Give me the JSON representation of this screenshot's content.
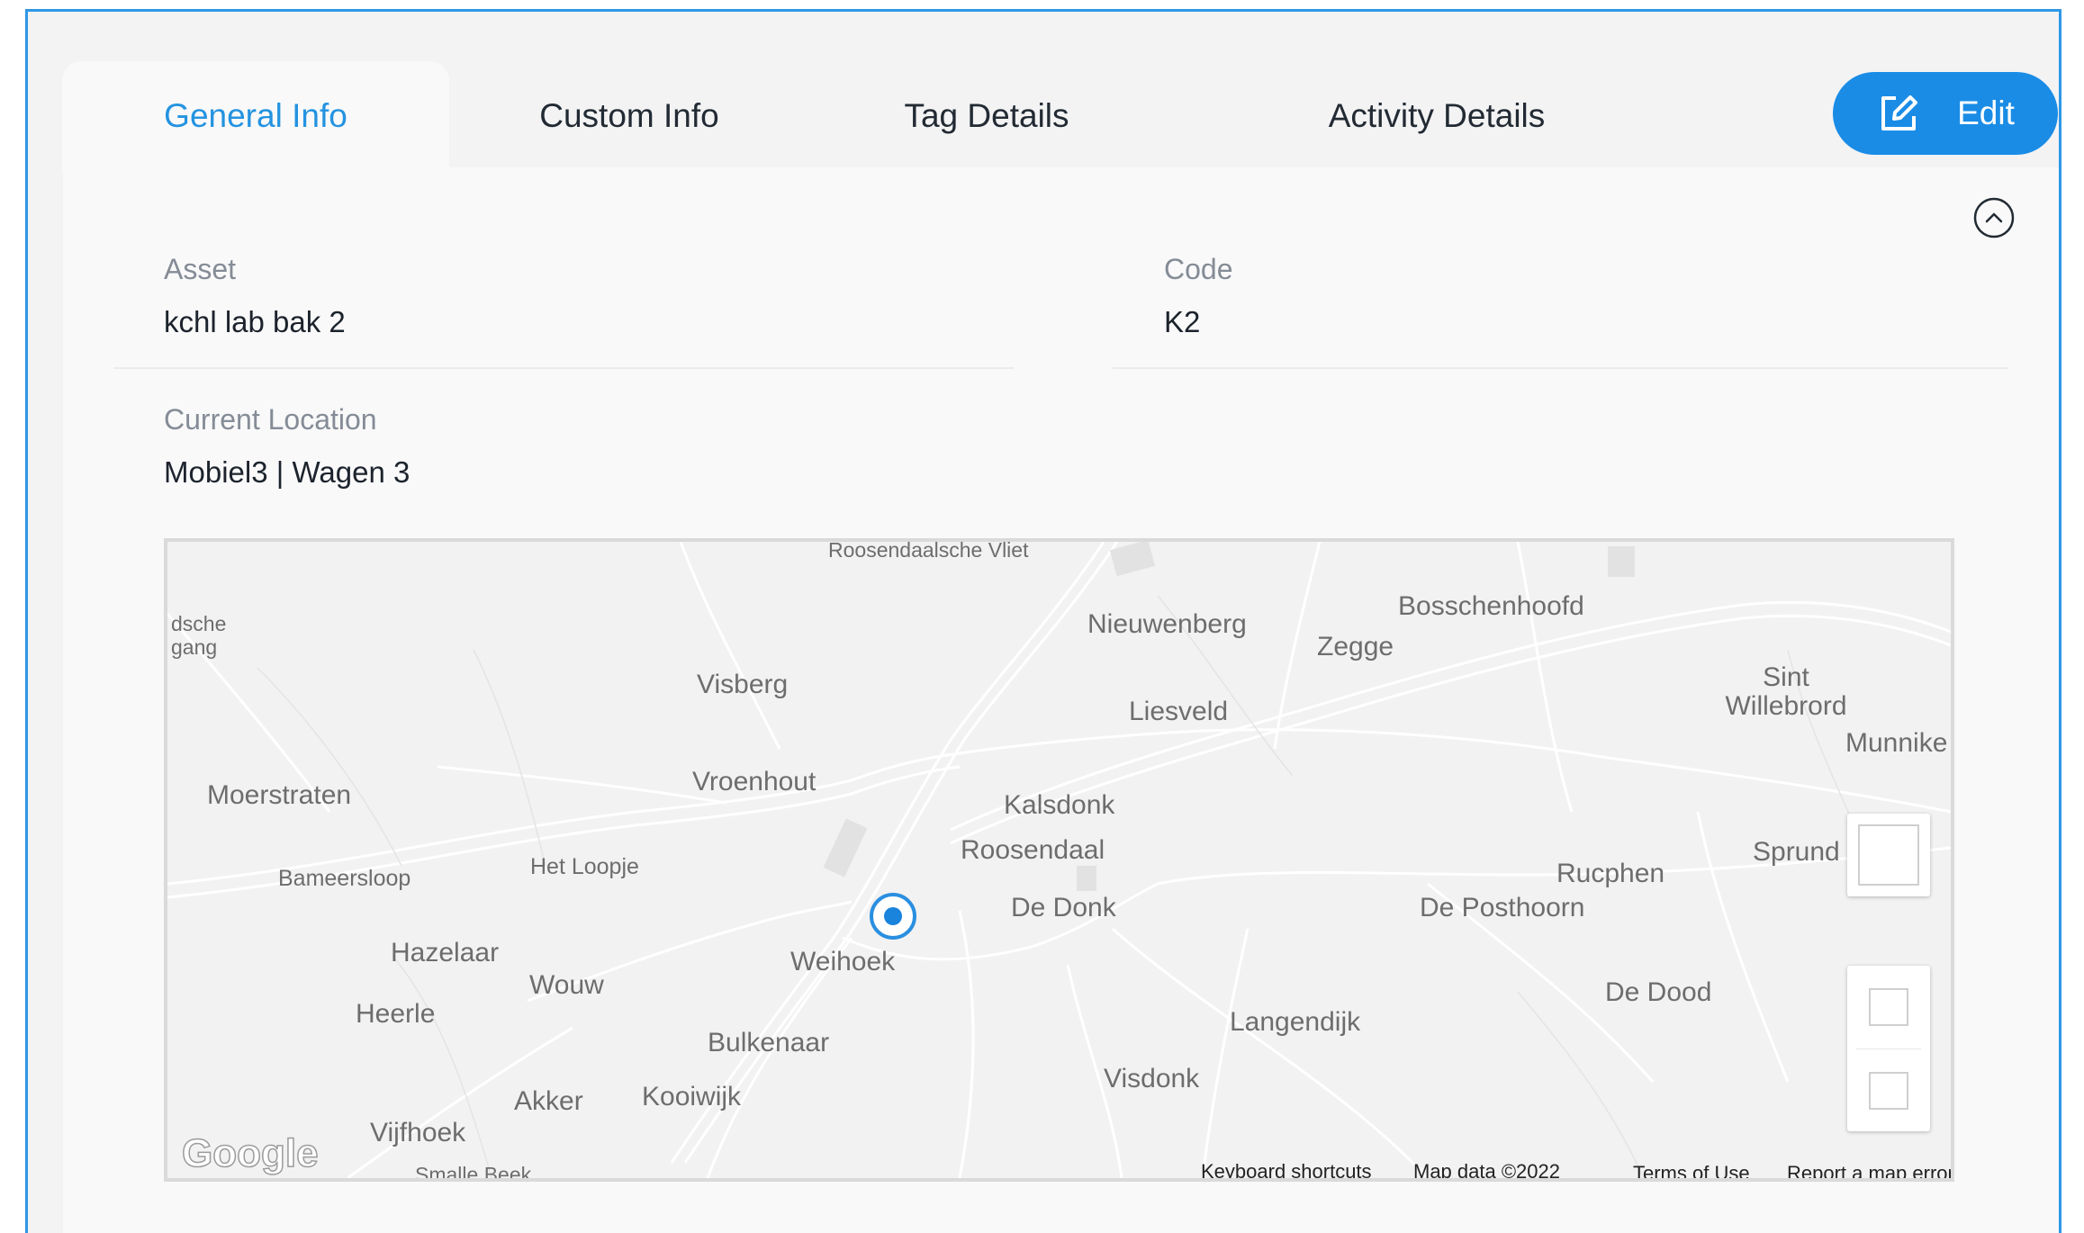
{
  "tabs": [
    {
      "label": "General Info",
      "active": true
    },
    {
      "label": "Custom Info",
      "active": false
    },
    {
      "label": "Tag Details",
      "active": false
    },
    {
      "label": "Activity Details",
      "active": false
    }
  ],
  "edit_button": {
    "label": "Edit",
    "icon": "edit-icon"
  },
  "collapse_icon": "chevron-up-circle-icon",
  "fields": {
    "asset": {
      "label": "Asset",
      "value": "kchl lab bak 2"
    },
    "code": {
      "label": "Code",
      "value": "K2"
    },
    "current_location": {
      "label": "Current Location",
      "value": "Mobiel3 | Wagen 3"
    }
  },
  "map": {
    "places": [
      "Roosendaalsche Vliet",
      "dsche gang",
      "Nieuwenberg",
      "Bosschenhoofd",
      "Zegge",
      "Visberg",
      "Liesveld",
      "Sint Willebrord",
      "Munnike",
      "Moerstraten",
      "Vroenhout",
      "Kalsdonk",
      "Roosendaal",
      "Sprund",
      "Bameersloop",
      "Het Loopje",
      "Rucphen",
      "De Donk",
      "De Posthoorn",
      "Hazelaar",
      "Weihoek",
      "Wouw",
      "De Dood",
      "Heerle",
      "Langendijk",
      "Bulkenaar",
      "Visdonk",
      "Akker",
      "Kooiwijk",
      "Vijfhoek",
      "Smalle Beek"
    ],
    "logo": "Google",
    "attribution": {
      "keyboard_shortcuts": "Keyboard shortcuts",
      "map_data": "Map data ©2022",
      "terms": "Terms of Use",
      "report": "Report a map error"
    },
    "marker_color": "#1a83dc"
  },
  "colors": {
    "accent": "#1a8ce6",
    "frame_border": "#2e97e6",
    "active_tab_text": "#2493e0"
  }
}
